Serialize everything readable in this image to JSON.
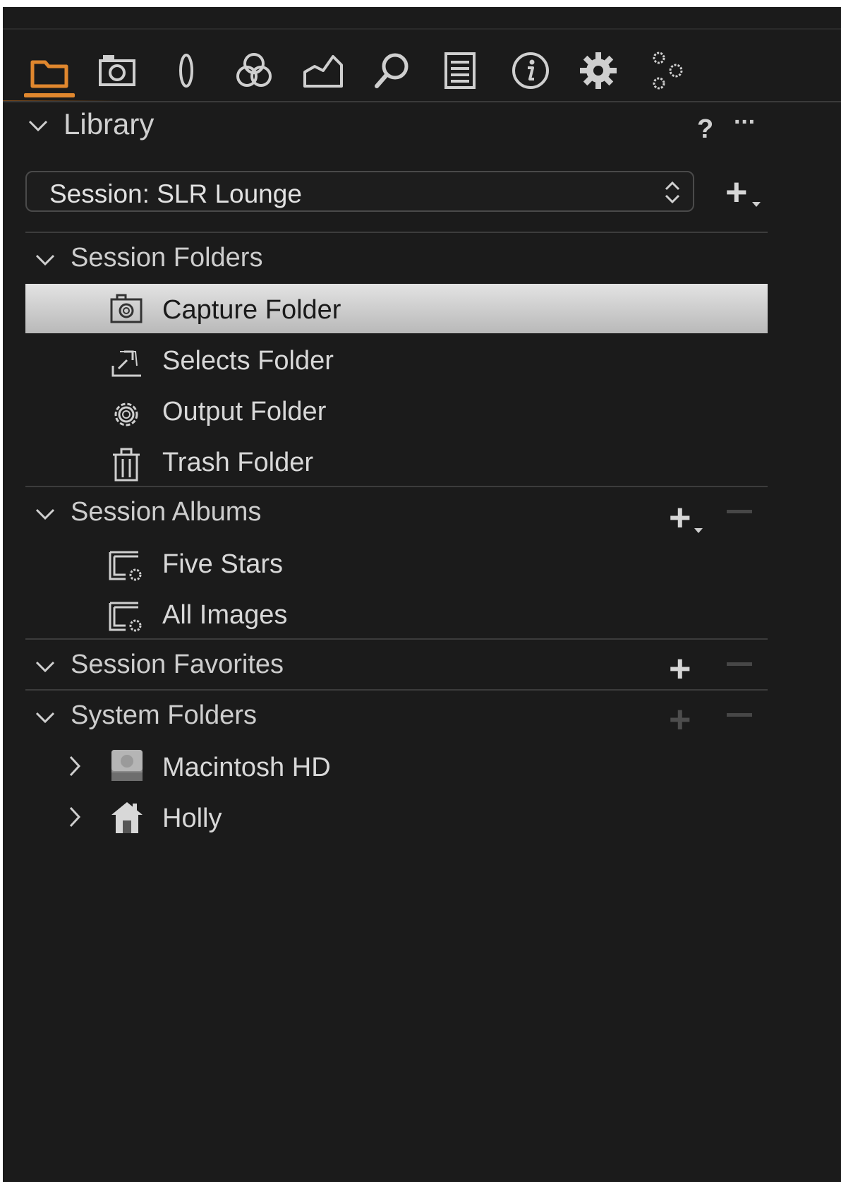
{
  "colors": {
    "panel_bg": "#1b1b1b",
    "accent": "#e0872e",
    "selection_bg": "#d0d0d0",
    "text": "#d8d8d8",
    "dim": "#4d4d4d"
  },
  "toolbar": {
    "tabs": [
      {
        "icon": "library-folder-icon",
        "active": true
      },
      {
        "icon": "capture-camera-icon",
        "active": false
      },
      {
        "icon": "lens-icon",
        "active": false
      },
      {
        "icon": "color-icon",
        "active": false
      },
      {
        "icon": "exposure-icon",
        "active": false
      },
      {
        "icon": "details-magnifier-icon",
        "active": false
      },
      {
        "icon": "metadata-list-icon",
        "active": false
      },
      {
        "icon": "info-icon",
        "active": false
      },
      {
        "icon": "adjustments-gear-icon",
        "active": false
      },
      {
        "icon": "batch-gears-icon",
        "active": false
      }
    ]
  },
  "library": {
    "title": "Library",
    "help": "?",
    "more": "···",
    "session_select": "Session: SLR Lounge",
    "add_symbol": "+"
  },
  "sections": {
    "folders": {
      "title": "Session Folders",
      "items": [
        {
          "label": "Capture Folder",
          "icon": "camera-icon",
          "selected": true
        },
        {
          "label": "Selects Folder",
          "icon": "selects-tray-icon",
          "selected": false
        },
        {
          "label": "Output Folder",
          "icon": "gear-icon",
          "selected": false
        },
        {
          "label": "Trash Folder",
          "icon": "trash-icon",
          "selected": false
        }
      ]
    },
    "albums": {
      "title": "Session Albums",
      "plus": "+",
      "items": [
        {
          "label": "Five Stars",
          "icon": "smart-album-icon"
        },
        {
          "label": "All Images",
          "icon": "smart-album-icon"
        }
      ]
    },
    "favorites": {
      "title": "Session Favorites",
      "plus": "+"
    },
    "system": {
      "title": "System Folders",
      "plus": "+",
      "items": [
        {
          "label": "Macintosh HD",
          "icon": "hard-drive-icon"
        },
        {
          "label": "Holly",
          "icon": "home-icon"
        }
      ]
    }
  }
}
